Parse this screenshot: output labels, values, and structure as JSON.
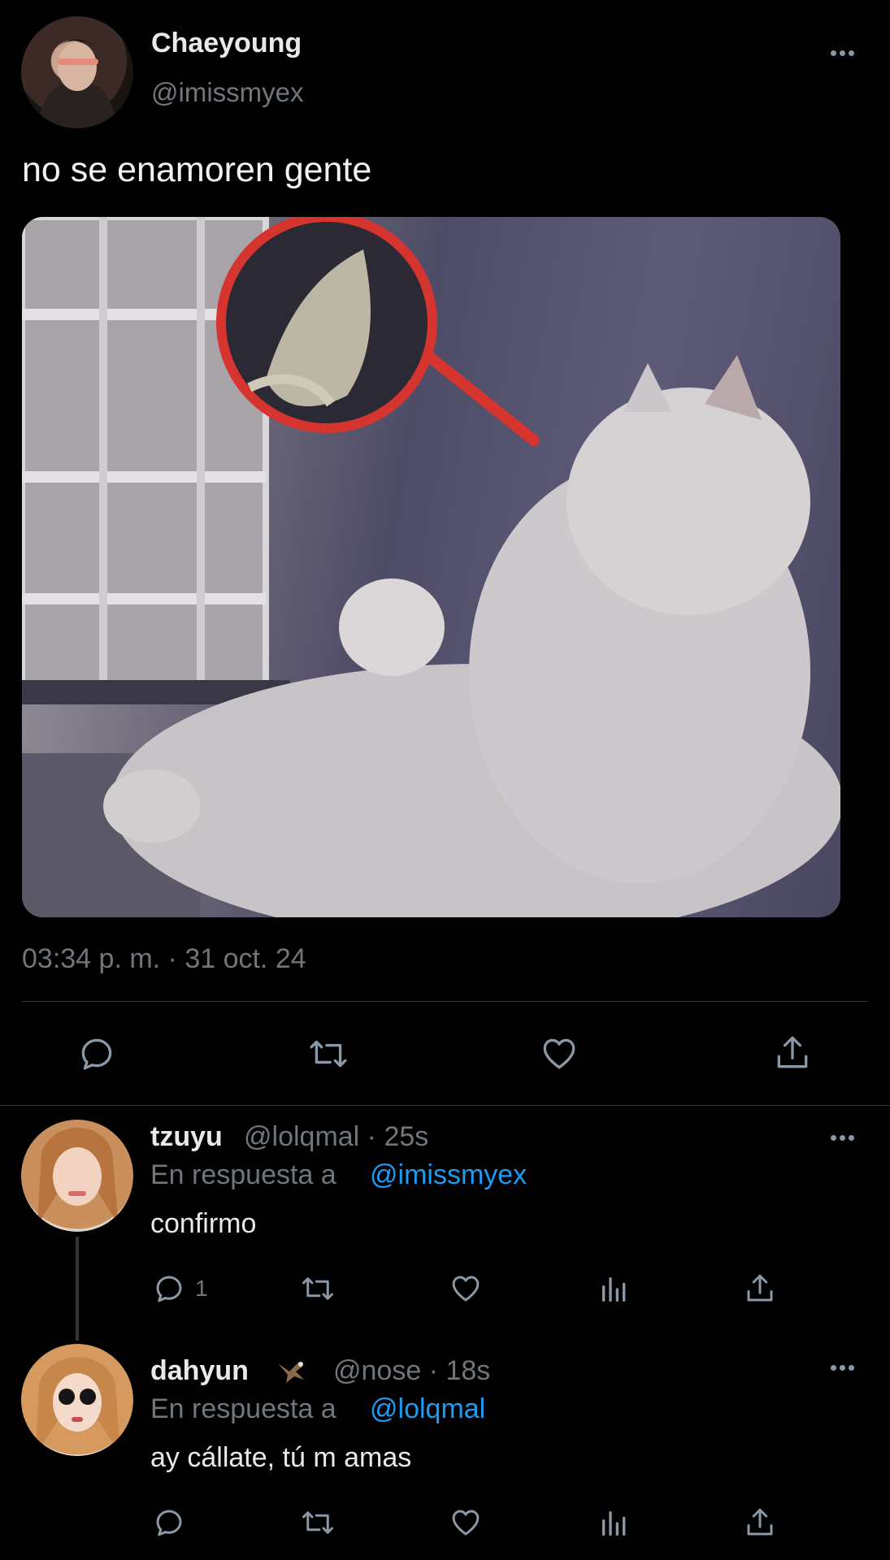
{
  "main_tweet": {
    "display_name": "Chaeyoung",
    "handle": "@imissmyex",
    "text": "no se enamoren gente",
    "timestamp": "03:34 p. m. · 31 oct. 24",
    "image_icon": "cat-watching-monitor-image",
    "actions": [
      "reply-icon",
      "retweet-icon",
      "like-icon",
      "share-icon"
    ]
  },
  "replies": [
    {
      "display_name": "tzuyu",
      "handle_time": "@lolqmal · 25s",
      "in_reply_prefix": "En respuesta a",
      "in_reply_handle": "@imissmyex",
      "text": "confirmo",
      "reply_count": "1"
    },
    {
      "display_name": "dahyun",
      "badge_icon": "eagle-emoji",
      "handle_time": "@nose · 18s",
      "in_reply_prefix": "En respuesta a",
      "in_reply_handle": "@lolqmal",
      "text": "ay cállate, tú m amas",
      "reply_count": ""
    }
  ],
  "colors": {
    "background": "#000000",
    "text": "#e7e9ea",
    "muted": "#71767b",
    "link": "#1d9bf0",
    "divider": "#2f3336"
  }
}
